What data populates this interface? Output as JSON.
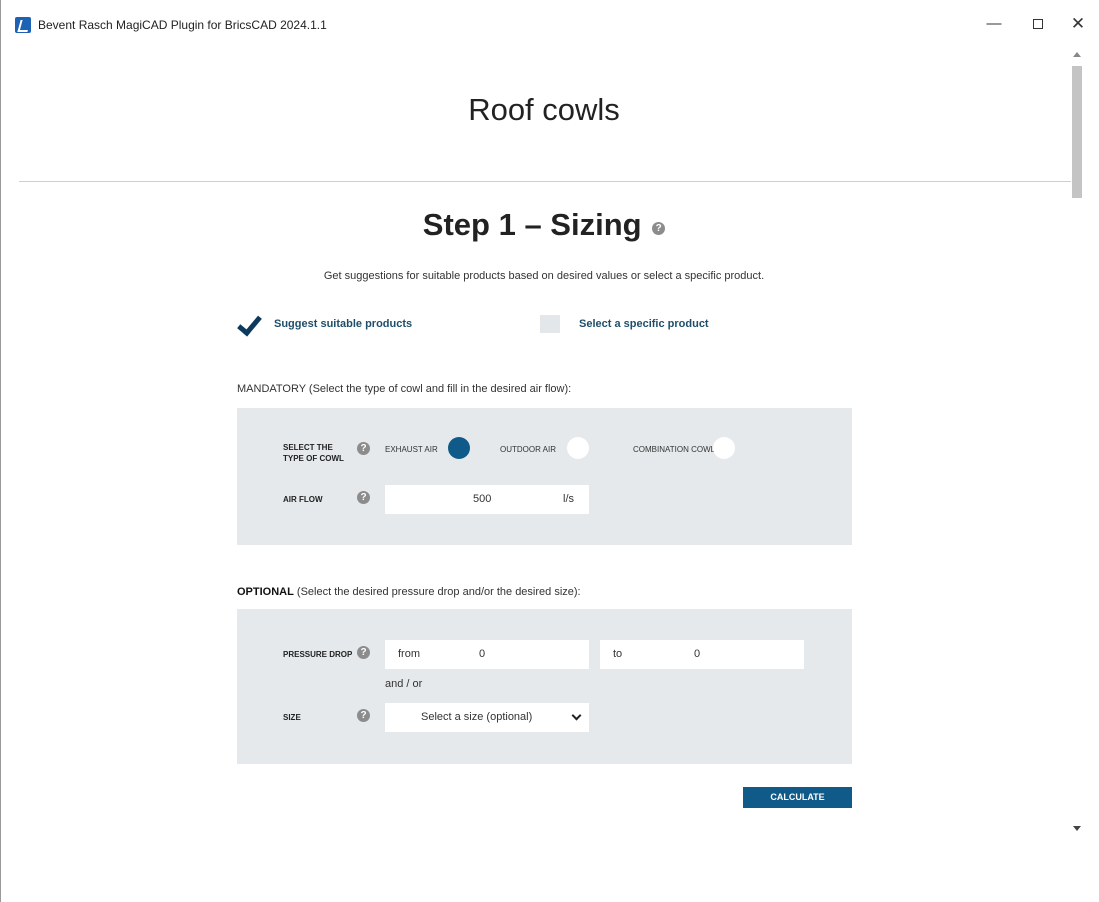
{
  "window": {
    "title": "Bevent Rasch MagiCAD Plugin for BricsCAD 2024.1.1",
    "minimize": "—",
    "close": "✕"
  },
  "page": {
    "title": "Roof cowls",
    "step_title": "Step 1 – Sizing",
    "help_glyph": "?",
    "intro": "Get suggestions for suitable products based on desired values or select a specific product."
  },
  "mode": {
    "suggest_label": "Suggest suitable products",
    "suggest_checked": true,
    "specific_label": "Select a specific product",
    "specific_checked": false
  },
  "mandatory": {
    "section_label": "MANDATORY (Select the type of cowl and fill in the desired air flow):",
    "type_label_line1": "SELECT THE",
    "type_label_line2": "TYPE OF COWL",
    "options": [
      {
        "label": "EXHAUST AIR",
        "selected": true
      },
      {
        "label": "OUTDOOR AIR",
        "selected": false
      },
      {
        "label": "COMBINATION COWL",
        "selected": false
      }
    ],
    "airflow_label": "AIR FLOW",
    "airflow_value": "500",
    "airflow_unit": "l/s"
  },
  "optional": {
    "section_label_bold": "OPTIONAL",
    "section_label_rest": " (Select the desired pressure drop and/or the desired size):",
    "pressure_label": "PRESSURE DROP",
    "from_label": "from",
    "from_value": "0",
    "to_label": "to",
    "to_value": "0",
    "and_or": "and / or",
    "size_label": "SIZE",
    "size_value": "Select a size (optional)"
  },
  "actions": {
    "calculate": "CALCULATE"
  },
  "colors": {
    "accent": "#0f5a89",
    "panel": "#e5e9ec",
    "label_blue": "#1f4e6b"
  }
}
